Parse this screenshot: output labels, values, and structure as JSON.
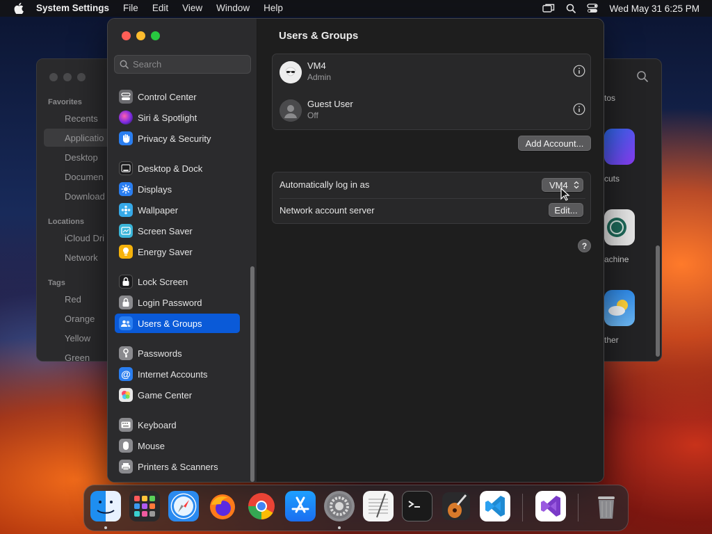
{
  "menubar": {
    "app_name": "System Settings",
    "menus": [
      "File",
      "Edit",
      "View",
      "Window",
      "Help"
    ],
    "clock": "Wed May 31  6:25 PM"
  },
  "finder": {
    "sections": [
      "Favorites",
      "Locations",
      "Tags"
    ],
    "favorites": [
      "Recents",
      "Applicatio",
      "Desktop",
      "Documen",
      "Download"
    ],
    "locations": [
      "iCloud Dri",
      "Network"
    ],
    "tags": [
      "Red",
      "Orange",
      "Yellow",
      "Green"
    ],
    "right_labels": [
      "tos",
      "cuts",
      "achine",
      "ther"
    ]
  },
  "sidebar": {
    "search_placeholder": "Search",
    "items": [
      {
        "label": "Control Center",
        "icon": "control-center-icon",
        "color": "#6b6b6f"
      },
      {
        "label": "Siri & Spotlight",
        "icon": "siri-icon",
        "color": "#9b3dd8"
      },
      {
        "label": "Privacy & Security",
        "icon": "privacy-hand-icon",
        "color": "#2a7ef0"
      },
      {
        "label": "Desktop & Dock",
        "icon": "desktop-dock-icon",
        "color": "#1c1c1e"
      },
      {
        "label": "Displays",
        "icon": "displays-icon",
        "color": "#2a7ef0"
      },
      {
        "label": "Wallpaper",
        "icon": "wallpaper-icon",
        "color": "#36a9e8"
      },
      {
        "label": "Screen Saver",
        "icon": "screen-saver-icon",
        "color": "#3ab5d8"
      },
      {
        "label": "Energy Saver",
        "icon": "energy-saver-icon",
        "color": "#f5b20b"
      },
      {
        "label": "Lock Screen",
        "icon": "lock-icon",
        "color": "#1c1c1e"
      },
      {
        "label": "Login Password",
        "icon": "login-password-icon",
        "color": "#8a8a8e"
      },
      {
        "label": "Users & Groups",
        "icon": "users-icon",
        "color": "#2a7ef0"
      },
      {
        "label": "Passwords",
        "icon": "key-icon",
        "color": "#8a8a8e"
      },
      {
        "label": "Internet Accounts",
        "icon": "at-icon",
        "color": "#2a7ef0"
      },
      {
        "label": "Game Center",
        "icon": "game-center-icon",
        "color": "#e8e8e8"
      },
      {
        "label": "Keyboard",
        "icon": "keyboard-icon",
        "color": "#8a8a8e"
      },
      {
        "label": "Mouse",
        "icon": "mouse-icon",
        "color": "#8a8a8e"
      },
      {
        "label": "Printers & Scanners",
        "icon": "printer-icon",
        "color": "#8a8a8e"
      }
    ]
  },
  "content": {
    "title": "Users & Groups",
    "users": [
      {
        "name": "VM4",
        "role": "Admin"
      },
      {
        "name": "Guest User",
        "role": "Off"
      }
    ],
    "add_account_label": "Add Account...",
    "auto_login_label": "Automatically log in as",
    "auto_login_value": "VM4",
    "network_server_label": "Network account server",
    "edit_label": "Edit...",
    "help_label": "?"
  },
  "dock": {
    "apps": [
      "finder-icon",
      "launchpad-icon",
      "safari-icon",
      "firefox-icon",
      "chrome-icon",
      "app-store-icon",
      "system-settings-icon",
      "textedit-icon",
      "terminal-icon",
      "garageband-icon",
      "vscode-icon",
      "visual-studio-icon",
      "trash-icon"
    ]
  },
  "colors": {
    "accent": "#0a5ad8",
    "window_bg": "#1e1e1e",
    "sidebar_bg": "#2b2b2d"
  }
}
